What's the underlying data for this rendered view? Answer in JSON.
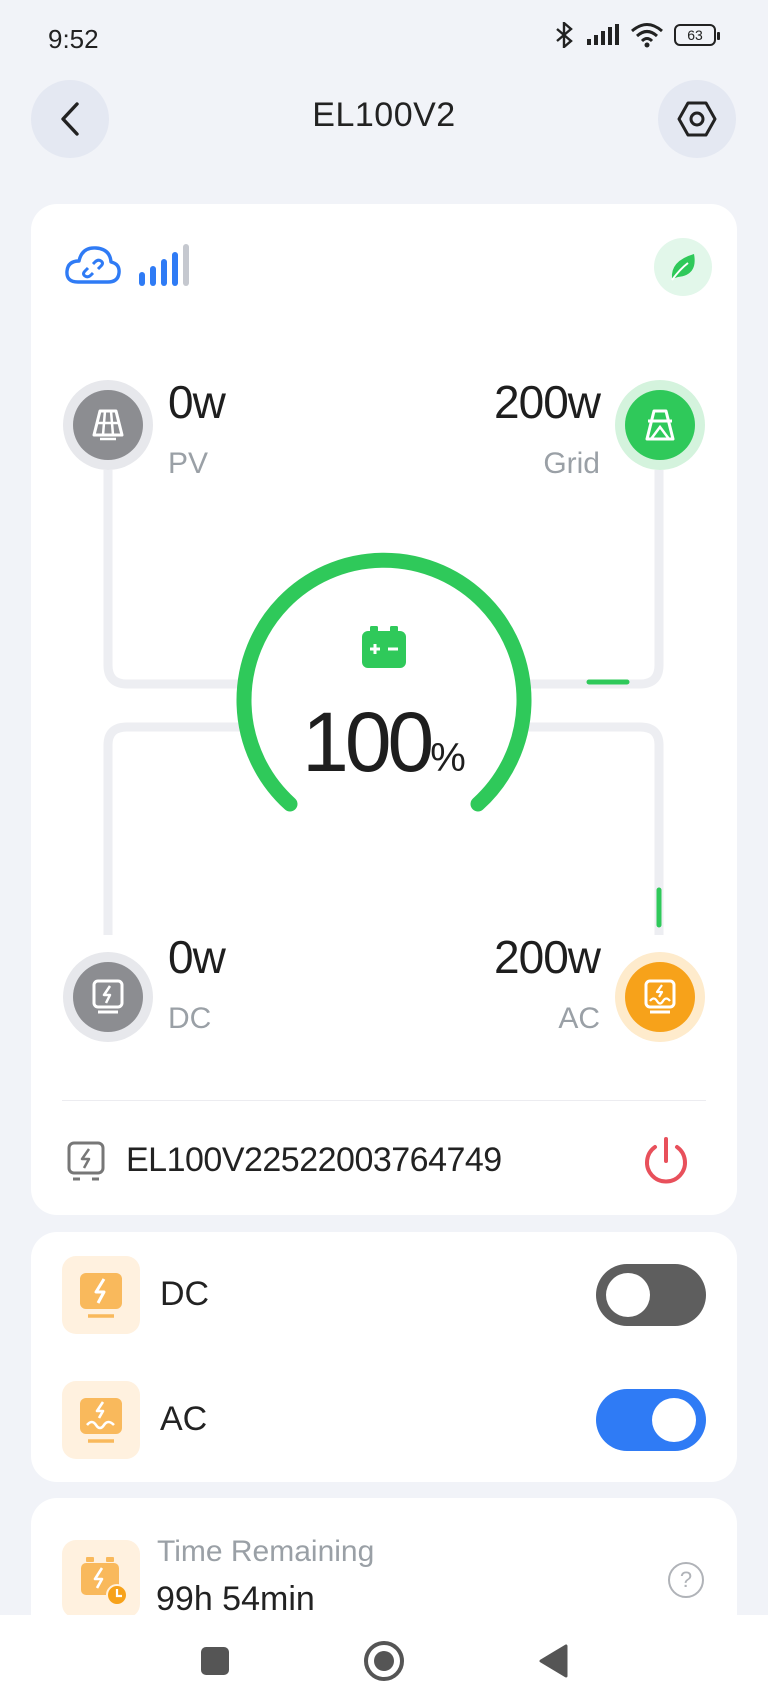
{
  "status_bar": {
    "time": "9:52",
    "battery": "63"
  },
  "header": {
    "title": "EL100V2"
  },
  "flow": {
    "pv": {
      "value": "0w",
      "label": "PV"
    },
    "grid": {
      "value": "200w",
      "label": "Grid"
    },
    "dc": {
      "value": "0w",
      "label": "DC"
    },
    "ac": {
      "value": "200w",
      "label": "AC"
    },
    "battery_percent": "100",
    "battery_unit": "%"
  },
  "device": {
    "serial": "EL100V22522003764749"
  },
  "outputs": [
    {
      "label": "DC",
      "enabled": false
    },
    {
      "label": "AC",
      "enabled": true
    }
  ],
  "time_remaining": {
    "label": "Time Remaining",
    "value": "99h 54min"
  },
  "colors": {
    "accent_green": "#2fc95a",
    "accent_orange": "#f7a21a",
    "toggle_on": "#2f7bf5",
    "toggle_off": "#5e5e5e",
    "power_red": "#e8505b"
  }
}
